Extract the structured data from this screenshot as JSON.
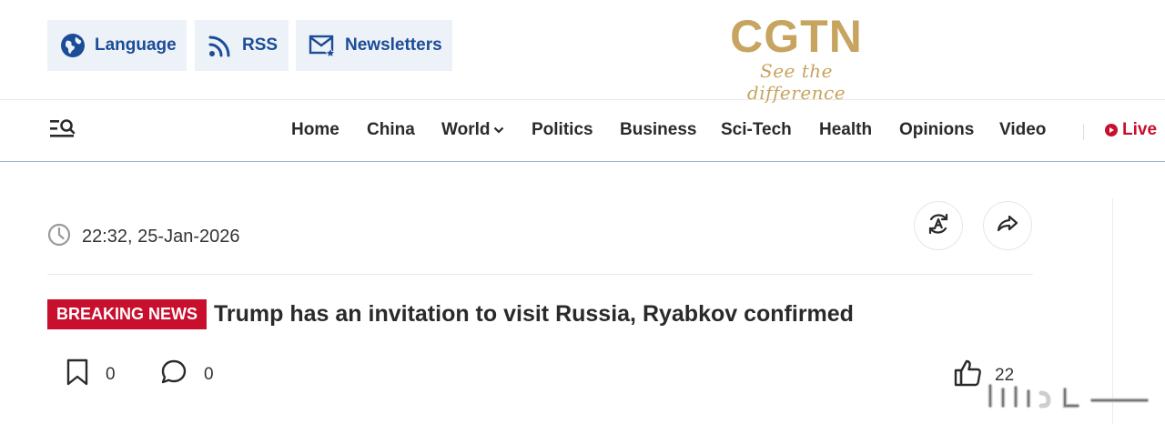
{
  "utility": {
    "language_label": "Language",
    "rss_label": "RSS",
    "newsletters_label": "Newsletters"
  },
  "logo": {
    "wordmark": "CGTN",
    "tagline": "See the difference"
  },
  "nav": {
    "items": [
      "Home",
      "China",
      "World",
      "Politics",
      "Business",
      "Sci-Tech",
      "Health",
      "Opinions",
      "Video"
    ],
    "live_label": "Live"
  },
  "article": {
    "timestamp": "22:32, 25-Jan-2026",
    "badge": "BREAKING NEWS",
    "headline": "Trump has an invitation to visit Russia, Ryabkov confirmed",
    "bookmark_count": "0",
    "comment_count": "0",
    "like_count": "22"
  },
  "colors": {
    "utility_bg": "#edf1f8",
    "utility_text": "#1b4c97",
    "logo_gold": "#c7a45f",
    "breaking_red": "#c8102e",
    "nav_border": "#9fb3cc"
  },
  "icons": [
    "globe-icon",
    "rss-icon",
    "mail-star-icon",
    "search-menu-icon",
    "chevron-down-icon",
    "live-play-icon",
    "clock-icon",
    "translate-icon",
    "share-icon",
    "bookmark-icon",
    "comment-icon",
    "thumbs-up-icon"
  ]
}
